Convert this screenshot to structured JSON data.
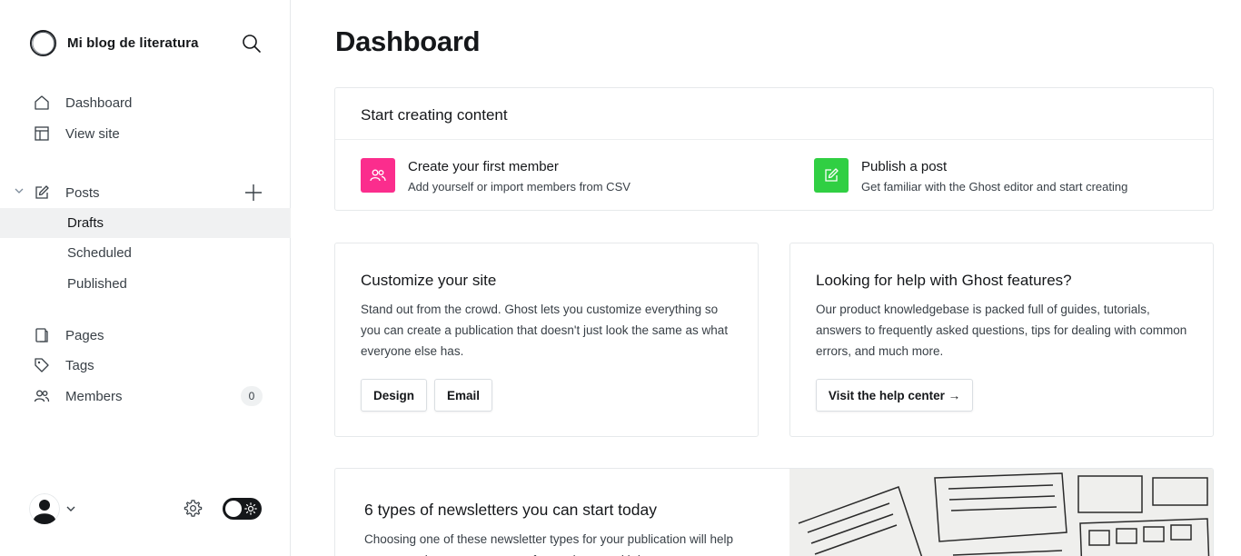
{
  "brand": {
    "name": "Mi blog de literatura"
  },
  "nav": {
    "dashboard": "Dashboard",
    "view_site": "View site",
    "posts": "Posts",
    "drafts": "Drafts",
    "scheduled": "Scheduled",
    "published": "Published",
    "pages": "Pages",
    "tags": "Tags",
    "members": "Members",
    "members_count": "0"
  },
  "main": {
    "title": "Dashboard",
    "start": {
      "heading": "Start creating content",
      "member_title": "Create your first member",
      "member_sub": "Add yourself or import members from CSV",
      "post_title": "Publish a post",
      "post_sub": "Get familiar with the Ghost editor and start creating"
    },
    "customize": {
      "title": "Customize your site",
      "desc": "Stand out from the crowd. Ghost lets you customize everything so you can create a publication that doesn't just look the same as what everyone else has.",
      "btn_design": "Design",
      "btn_email": "Email"
    },
    "help": {
      "title": "Looking for help with Ghost features?",
      "desc": "Our product knowledgebase is packed full of guides, tutorials, answers to frequently asked questions, tips for dealing with common errors, and much more.",
      "btn": "Visit the help center →"
    },
    "newsletter": {
      "title": "6 types of newsletters you can start today",
      "desc": "Choosing one of these newsletter types for your publication will help you create better content, stay focused, grow with less..."
    }
  },
  "colors": {
    "member_icon_bg": "#fb2d8d",
    "post_icon_bg": "#30cf43"
  },
  "icons": [
    "search-icon",
    "home-icon",
    "layout-icon",
    "edit-icon",
    "plus-icon",
    "pages-icon",
    "tag-icon",
    "members-icon",
    "gear-icon",
    "sun-icon",
    "chevron-down-icon"
  ]
}
